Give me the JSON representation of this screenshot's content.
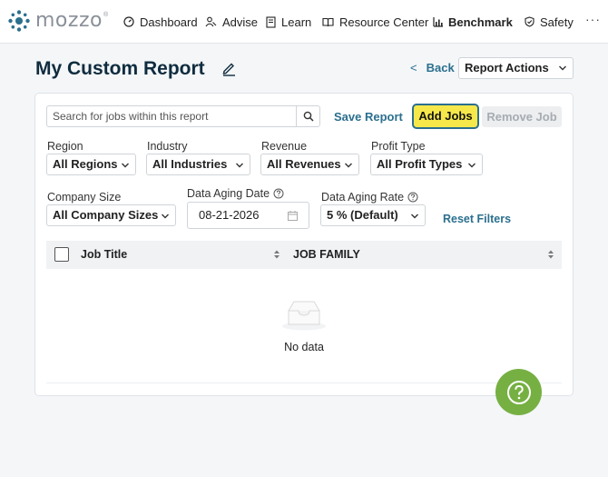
{
  "app": {
    "logo_text": "mozzo",
    "logo_mark": "®"
  },
  "nav": {
    "items": [
      {
        "label": "Dashboard",
        "icon": "gauge-icon"
      },
      {
        "label": "Advise",
        "icon": "people-icon"
      },
      {
        "label": "Learn",
        "icon": "book-icon"
      },
      {
        "label": "Resource Center",
        "icon": "open-book-icon"
      },
      {
        "label": "Benchmark",
        "icon": "bar-chart-icon",
        "active": true
      },
      {
        "label": "Safety",
        "icon": "shield-icon"
      }
    ],
    "more": "···"
  },
  "header": {
    "title": "My Custom Report",
    "back_label": "Back",
    "report_actions_label": "Report Actions"
  },
  "toolbar": {
    "search_placeholder": "Search for jobs within this report",
    "save_report_label": "Save Report",
    "add_jobs_label": "Add Jobs",
    "remove_job_label": "Remove Job"
  },
  "filters": {
    "region": {
      "label": "Region",
      "value": "All Regions"
    },
    "industry": {
      "label": "Industry",
      "value": "All Industries"
    },
    "revenue": {
      "label": "Revenue",
      "value": "All Revenues"
    },
    "profit_type": {
      "label": "Profit Type",
      "value": "All Profit Types"
    },
    "company_size": {
      "label": "Company Size",
      "value": "All Company Sizes"
    },
    "data_aging_date": {
      "label": "Data Aging Date",
      "value": "08-21-2026"
    },
    "data_aging_rate": {
      "label": "Data Aging Rate",
      "value": "5 % (Default)"
    },
    "reset_label": "Reset Filters"
  },
  "table": {
    "columns": [
      "Job Title",
      "JOB FAMILY"
    ],
    "rows": [],
    "empty_text": "No data"
  },
  "colors": {
    "accent": "#2b6f8e",
    "title": "#0f2c3f",
    "add_jobs_bg": "#f6e84a",
    "help_fab": "#76b043"
  }
}
